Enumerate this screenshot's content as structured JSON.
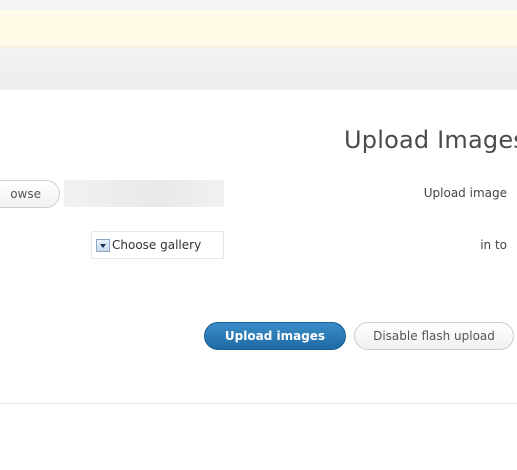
{
  "panel": {
    "title": "Upload Images",
    "browse_label": "owse",
    "file_path_value": "",
    "upload_image_label": "Upload image",
    "gallery_select": "Choose gallery",
    "into_label": "in to",
    "upload_button": "Upload images",
    "disable_flash_button": "Disable flash upload"
  },
  "colors": {
    "notice_bg": "#fffbe6",
    "header_bar": "#efefef",
    "primary_button": "#2b7bb9"
  },
  "icons": {
    "gallery_select_arrow": "chevron-down-icon"
  }
}
